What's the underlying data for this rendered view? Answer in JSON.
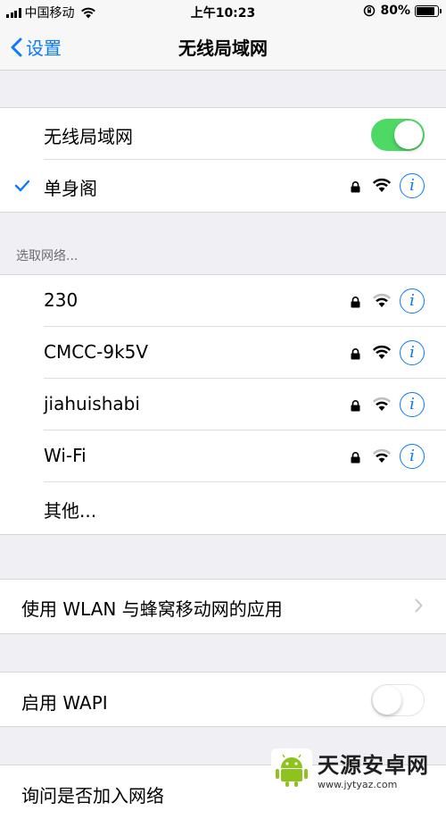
{
  "status_bar": {
    "carrier": "中国移动",
    "time": "上午10:23",
    "battery_percent_text": "80%",
    "battery_level": 0.8
  },
  "nav": {
    "back_label": "设置",
    "title": "无线局域网"
  },
  "wifi_toggle": {
    "label": "无线局域网",
    "on": true
  },
  "connected_network": {
    "name": "单身阁",
    "secured": true,
    "info_symbol": "i"
  },
  "choose_network_header": "选取网络...",
  "networks": [
    {
      "name": "230",
      "secured": true,
      "info_symbol": "i"
    },
    {
      "name": "CMCC-9k5V",
      "secured": true,
      "info_symbol": "i"
    },
    {
      "name": "jiahuishabi",
      "secured": true,
      "info_symbol": "i"
    },
    {
      "name": "Wi-Fi",
      "secured": true,
      "info_symbol": "i"
    }
  ],
  "other_label": "其他...",
  "wlan_apps_label": "使用 WLAN 与蜂窝移动网的应用",
  "wapi": {
    "label": "启用 WAPI",
    "on": false
  },
  "ask_join_label": "询问是否加入网络",
  "watermark": {
    "title": "天源安卓网",
    "url": "www.jytyaz.com"
  },
  "colors": {
    "accent": "#0a7aff",
    "toggle_on": "#4cd964",
    "background": "#efeff4"
  },
  "icons": [
    "signal-bars-icon",
    "wifi-icon",
    "orientation-lock-icon",
    "battery-icon",
    "chevron-left-icon",
    "checkmark-icon",
    "lock-icon",
    "info-icon",
    "chevron-right-icon"
  ]
}
